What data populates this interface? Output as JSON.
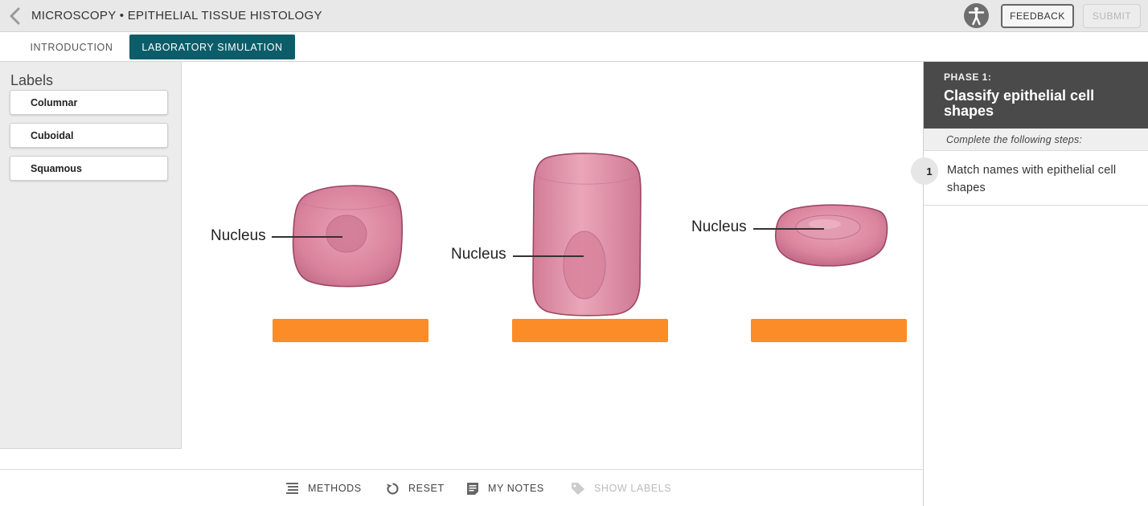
{
  "header": {
    "title": "MICROSCOPY • EPITHELIAL TISSUE HISTOLOGY",
    "back_icon": "chevron-left-icon",
    "accessibility_icon": "accessibility-icon",
    "feedback_label": "FEEDBACK",
    "submit_label": "SUBMIT"
  },
  "tabs": [
    {
      "label": "INTRODUCTION",
      "active": false
    },
    {
      "label": "LABORATORY SIMULATION",
      "active": true
    }
  ],
  "labels_panel": {
    "title": "Labels",
    "items": [
      {
        "label": "Columnar"
      },
      {
        "label": "Cuboidal"
      },
      {
        "label": "Squamous"
      }
    ]
  },
  "stage": {
    "cells": [
      {
        "shape": "cuboidal",
        "nucleus_label": "Nucleus"
      },
      {
        "shape": "columnar",
        "nucleus_label": "Nucleus"
      },
      {
        "shape": "squamous",
        "nucleus_label": "Nucleus"
      }
    ],
    "drop_zone_color": "#fc8c28",
    "cell_color": "#d9829c"
  },
  "toolbar": {
    "methods": {
      "label": "METHODS",
      "icon": "list-icon"
    },
    "reset": {
      "label": "RESET",
      "icon": "reset-icon"
    },
    "notes": {
      "label": "MY NOTES",
      "icon": "notes-icon"
    },
    "show_labels": {
      "label": "SHOW LABELS",
      "icon": "tag-icon",
      "disabled": true
    }
  },
  "right_panel": {
    "phase_number": "PHASE 1:",
    "phase_title": "Classify epithelial cell shapes",
    "steps_caption": "Complete the following steps:",
    "steps": [
      {
        "number": "1",
        "text": "Match names with epithelial cell shapes"
      }
    ]
  },
  "colors": {
    "accent": "#0b5d6a",
    "header_bg": "#e8e8e8",
    "phase_bg": "#4a4a4a"
  }
}
